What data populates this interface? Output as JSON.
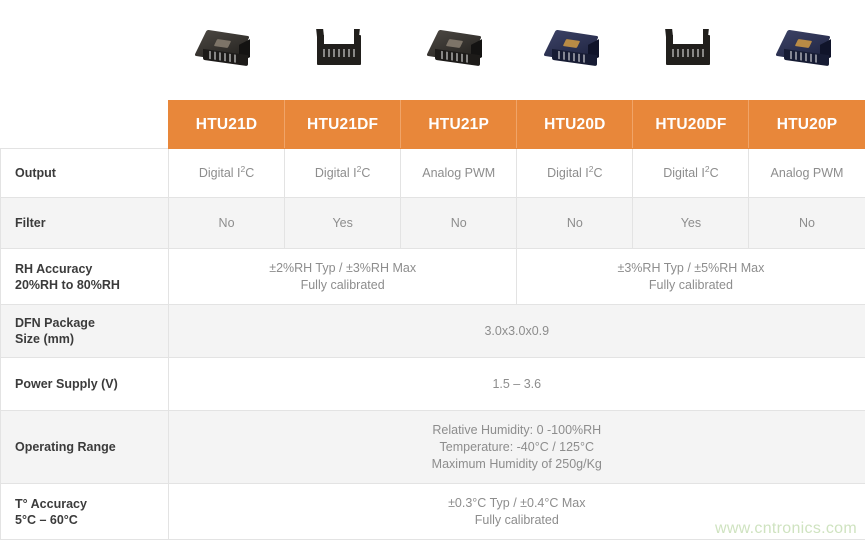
{
  "products": [
    {
      "name": "HTU21D",
      "package_color": "black",
      "has_filter_cap": false
    },
    {
      "name": "HTU21DF",
      "package_color": "black",
      "has_filter_cap": true
    },
    {
      "name": "HTU21P",
      "package_color": "black",
      "has_filter_cap": false
    },
    {
      "name": "HTU20D",
      "package_color": "navy",
      "has_filter_cap": false
    },
    {
      "name": "HTU20DF",
      "package_color": "black",
      "has_filter_cap": true
    },
    {
      "name": "HTU20P",
      "package_color": "navy",
      "has_filter_cap": false
    }
  ],
  "header": {
    "columns": [
      "HTU21D",
      "HTU21DF",
      "HTU21P",
      "HTU20D",
      "HTU20DF",
      "HTU20P"
    ],
    "background_color": "#E8873A",
    "text_color": "#FFFFFF"
  },
  "rows": {
    "output": {
      "label": "Output",
      "cells": [
        "Digital I2C",
        "Digital I2C",
        "Analog PWM",
        "Digital I2C",
        "Digital I2C",
        "Analog PWM"
      ]
    },
    "filter": {
      "label": "Filter",
      "cells": [
        "No",
        "Yes",
        "No",
        "No",
        "Yes",
        "No"
      ]
    },
    "rh_accuracy": {
      "label_line1": "RH Accuracy",
      "label_line2": "20%RH to 80%RH",
      "merged_left_line1": "±2%RH Typ / ±3%RH Max",
      "merged_left_line2": "Fully calibrated",
      "merged_right_line1": "±3%RH Typ / ±5%RH Max",
      "merged_right_line2": "Fully calibrated"
    },
    "dfn_package": {
      "label_line1": "DFN Package",
      "label_line2": "Size (mm)",
      "value": "3.0x3.0x0.9"
    },
    "power_supply": {
      "label": "Power Supply (V)",
      "value": "1.5 – 3.6"
    },
    "operating_range": {
      "label": "Operating Range",
      "line1": "Relative Humidity: 0 -100%RH",
      "line2": "Temperature: -40°C / 125°C",
      "line3": "Maximum Humidity of 250g/Kg"
    },
    "t_accuracy": {
      "label_line1": "T° Accuracy",
      "label_line2": "5°C – 60°C",
      "line1": "±0.3°C Typ / ±0.4°C Max",
      "line2": "Fully calibrated"
    }
  },
  "watermark": {
    "text": "www.cntronics.com",
    "color": "#CFE3C0"
  }
}
